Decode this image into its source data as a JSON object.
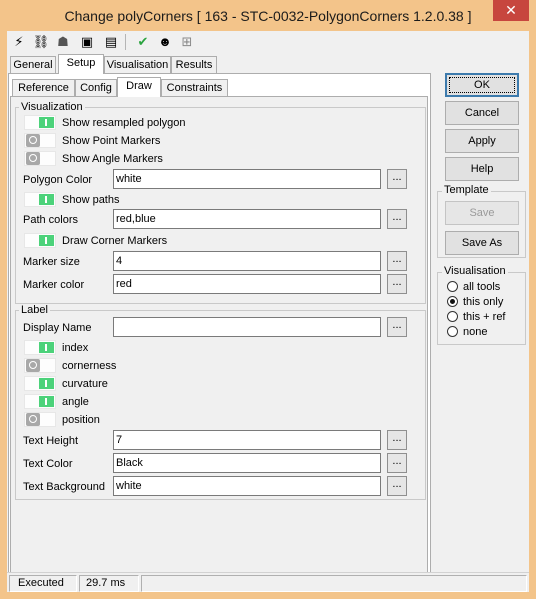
{
  "window": {
    "title": "Change polyCorners [ 163 - STC-0032-PolygonCorners 1.2.0.38 ]",
    "close_glyph": "✕"
  },
  "toolbar": [
    {
      "icon": "lightning-icon",
      "glyph": "⚡"
    },
    {
      "icon": "link-icon",
      "glyph": "⛓"
    },
    {
      "icon": "puzzle-icon",
      "glyph": "☗"
    },
    {
      "icon": "console-icon",
      "glyph": "▣"
    },
    {
      "icon": "document-icon",
      "glyph": "▤"
    },
    {
      "icon": "check-icon",
      "glyph": "✔"
    },
    {
      "icon": "user-settings-icon",
      "glyph": "☻"
    },
    {
      "icon": "grid-icon",
      "glyph": "⊞"
    }
  ],
  "tabs": [
    "General",
    "Setup",
    "Visualisation",
    "Results"
  ],
  "subtabs": [
    "Reference",
    "Config",
    "Draw",
    "Constraints"
  ],
  "visualization": {
    "legend": "Visualization",
    "show_resampled": {
      "label": "Show resampled polygon",
      "on": true
    },
    "show_point_markers": {
      "label": "Show Point Markers",
      "on": false
    },
    "show_angle_markers": {
      "label": "Show Angle Markers",
      "on": false
    },
    "polygon_color": {
      "label": "Polygon Color",
      "value": "white"
    },
    "show_paths": {
      "label": "Show paths",
      "on": true
    },
    "path_colors": {
      "label": "Path colors",
      "value": "red,blue"
    },
    "draw_corner_markers": {
      "label": "Draw Corner Markers",
      "on": true
    },
    "marker_size": {
      "label": "Marker size",
      "value": "4"
    },
    "marker_color": {
      "label": "Marker color",
      "value": "red"
    }
  },
  "label": {
    "legend": "Label",
    "display_name": {
      "label": "Display Name",
      "value": ""
    },
    "index": {
      "label": "index",
      "on": true
    },
    "cornerness": {
      "label": "cornerness",
      "on": false
    },
    "curvature": {
      "label": "curvature",
      "on": true
    },
    "angle": {
      "label": "angle",
      "on": true
    },
    "position": {
      "label": "position",
      "on": false
    },
    "text_height": {
      "label": "Text Height",
      "value": "7"
    },
    "text_color": {
      "label": "Text Color",
      "value": "Black"
    },
    "text_background": {
      "label": "Text Background",
      "value": "white"
    }
  },
  "ellipsis": "...",
  "buttons": {
    "ok": "OK",
    "cancel": "Cancel",
    "apply": "Apply",
    "help": "Help"
  },
  "template": {
    "legend": "Template",
    "save": "Save",
    "save_as": "Save As"
  },
  "visualisation_group": {
    "legend": "Visualisation",
    "options": [
      "all tools",
      "this only",
      "this + ref",
      "none"
    ],
    "selected": "this only"
  },
  "status": {
    "state": "Executed",
    "time": "29.7 ms"
  },
  "colors": {
    "toggle_on": "#4cd27a",
    "toggle_off": "#a8a8a8",
    "title_bar": "#f3c48a",
    "close_button": "#c7463e"
  }
}
